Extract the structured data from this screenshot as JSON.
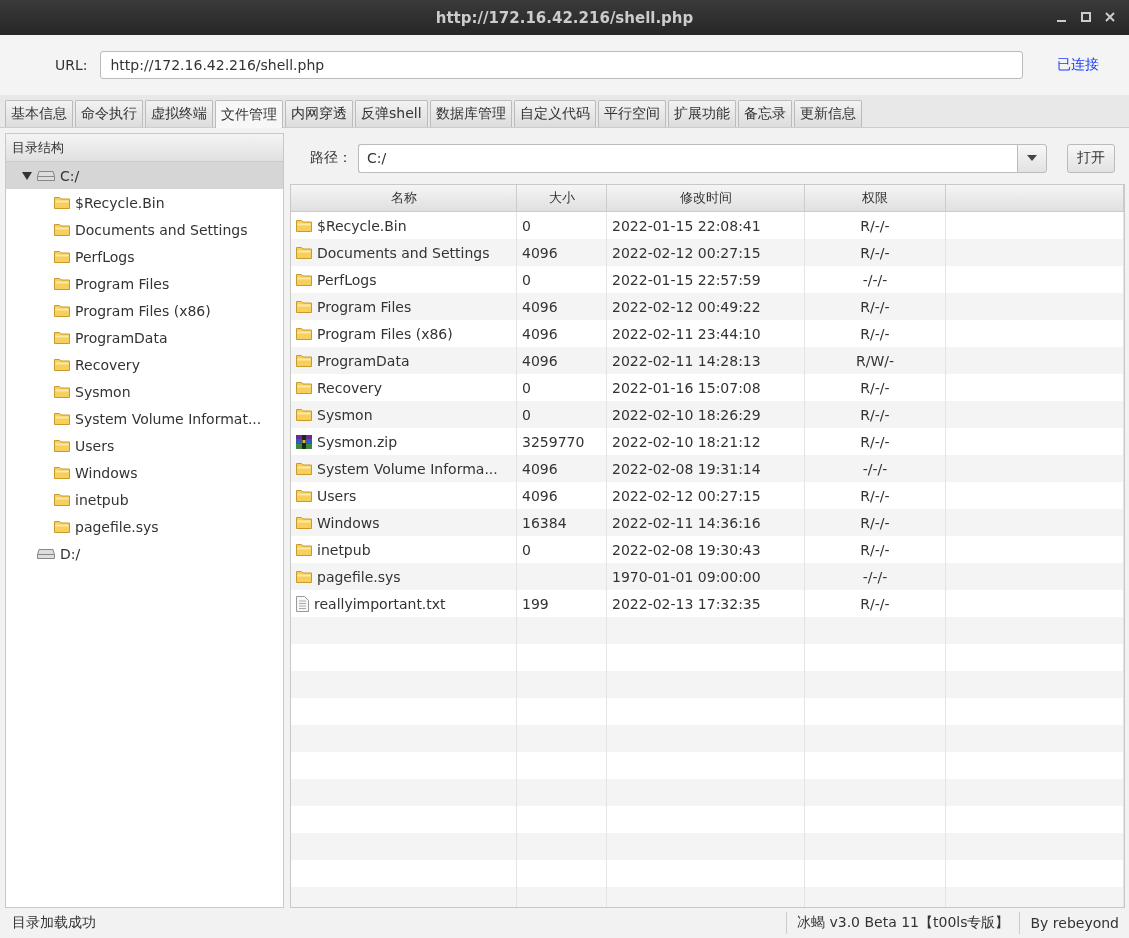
{
  "window": {
    "title": "http://172.16.42.216/shell.php"
  },
  "url_bar": {
    "label": "URL:",
    "value": "http://172.16.42.216/shell.php",
    "status": "已连接"
  },
  "tabs": [
    {
      "label": "基本信息",
      "selected": false
    },
    {
      "label": "命令执行",
      "selected": false
    },
    {
      "label": "虚拟终端",
      "selected": false
    },
    {
      "label": "文件管理",
      "selected": true
    },
    {
      "label": "内网穿透",
      "selected": false
    },
    {
      "label": "反弹shell",
      "selected": false
    },
    {
      "label": "数据库管理",
      "selected": false
    },
    {
      "label": "自定义代码",
      "selected": false
    },
    {
      "label": "平行空间",
      "selected": false
    },
    {
      "label": "扩展功能",
      "selected": false
    },
    {
      "label": "备忘录",
      "selected": false
    },
    {
      "label": "更新信息",
      "selected": false
    }
  ],
  "tree": {
    "title": "目录结构",
    "nodes": [
      {
        "label": "C:/",
        "kind": "drive",
        "expanded": true,
        "selected": true,
        "children": [
          {
            "label": "$Recycle.Bin",
            "kind": "folder",
            "selected": false
          },
          {
            "label": "Documents and Settings",
            "kind": "folder",
            "selected": false
          },
          {
            "label": "PerfLogs",
            "kind": "folder",
            "selected": false
          },
          {
            "label": "Program Files",
            "kind": "folder",
            "selected": false
          },
          {
            "label": "Program Files (x86)",
            "kind": "folder",
            "selected": false
          },
          {
            "label": "ProgramData",
            "kind": "folder",
            "selected": false
          },
          {
            "label": "Recovery",
            "kind": "folder",
            "selected": false
          },
          {
            "label": "Sysmon",
            "kind": "folder",
            "selected": false
          },
          {
            "label": "System Volume Informat...",
            "kind": "folder",
            "selected": false
          },
          {
            "label": "Users",
            "kind": "folder",
            "selected": false
          },
          {
            "label": "Windows",
            "kind": "folder",
            "selected": false
          },
          {
            "label": "inetpub",
            "kind": "folder",
            "selected": false
          },
          {
            "label": "pagefile.sys",
            "kind": "folder",
            "selected": false
          }
        ]
      },
      {
        "label": "D:/",
        "kind": "drive",
        "selected": false
      }
    ]
  },
  "path_bar": {
    "label": "路径：",
    "value": "C:/",
    "button": "打开"
  },
  "table": {
    "columns": [
      "名称",
      "大小",
      "修改时间",
      "权限"
    ],
    "rows": [
      {
        "kind": "folder",
        "name": "$Recycle.Bin",
        "size": "0",
        "modified": "2022-01-15 22:08:41",
        "permission": "R/-/-"
      },
      {
        "kind": "folder",
        "name": "Documents and Settings",
        "size": "4096",
        "modified": "2022-02-12 00:27:15",
        "permission": "R/-/-"
      },
      {
        "kind": "folder",
        "name": "PerfLogs",
        "size": "0",
        "modified": "2022-01-15 22:57:59",
        "permission": "-/-/-"
      },
      {
        "kind": "folder",
        "name": "Program Files",
        "size": "4096",
        "modified": "2022-02-12 00:49:22",
        "permission": "R/-/-"
      },
      {
        "kind": "folder",
        "name": "Program Files (x86)",
        "size": "4096",
        "modified": "2022-02-11 23:44:10",
        "permission": "R/-/-"
      },
      {
        "kind": "folder",
        "name": "ProgramData",
        "size": "4096",
        "modified": "2022-02-11 14:28:13",
        "permission": "R/W/-"
      },
      {
        "kind": "folder",
        "name": "Recovery",
        "size": "0",
        "modified": "2022-01-16 15:07:08",
        "permission": "R/-/-"
      },
      {
        "kind": "folder",
        "name": "Sysmon",
        "size": "0",
        "modified": "2022-02-10 18:26:29",
        "permission": "R/-/-"
      },
      {
        "kind": "archive",
        "name": "Sysmon.zip",
        "size": "3259770",
        "modified": "2022-02-10 18:21:12",
        "permission": "R/-/-"
      },
      {
        "kind": "folder",
        "name": "System Volume Informa...",
        "size": "4096",
        "modified": "2022-02-08 19:31:14",
        "permission": "-/-/-"
      },
      {
        "kind": "folder",
        "name": "Users",
        "size": "4096",
        "modified": "2022-02-12 00:27:15",
        "permission": "R/-/-"
      },
      {
        "kind": "folder",
        "name": "Windows",
        "size": "16384",
        "modified": "2022-02-11 14:36:16",
        "permission": "R/-/-"
      },
      {
        "kind": "folder",
        "name": "inetpub",
        "size": "0",
        "modified": "2022-02-08 19:30:43",
        "permission": "R/-/-"
      },
      {
        "kind": "folder",
        "name": "pagefile.sys",
        "modified": "1970-01-01 09:00:00",
        "permission": "-/-/-"
      },
      {
        "kind": "text",
        "name": "reallyimportant.txt",
        "size": "199",
        "modified": "2022-02-13 17:32:35",
        "permission": "R/-/-"
      }
    ]
  },
  "status_bar": {
    "message": "目录加载成功",
    "version": "冰蝎 v3.0 Beta 11【t00ls专版】",
    "author": "By rebeyond"
  }
}
